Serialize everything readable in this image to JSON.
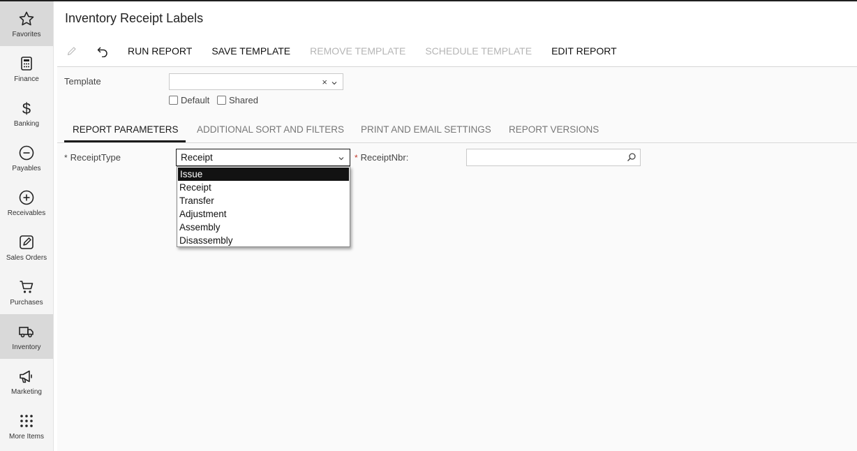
{
  "page": {
    "title": "Inventory Receipt Labels"
  },
  "sidebar": {
    "items": [
      {
        "label": "Favorites",
        "icon": "star-icon",
        "active": true
      },
      {
        "label": "Finance",
        "icon": "calculator-icon"
      },
      {
        "label": "Banking",
        "icon": "dollar-icon"
      },
      {
        "label": "Payables",
        "icon": "minus-circle-icon"
      },
      {
        "label": "Receivables",
        "icon": "plus-circle-icon"
      },
      {
        "label": "Sales Orders",
        "icon": "edit-icon"
      },
      {
        "label": "Purchases",
        "icon": "cart-icon"
      },
      {
        "label": "Inventory",
        "icon": "truck-icon",
        "active": true
      },
      {
        "label": "Marketing",
        "icon": "megaphone-icon"
      },
      {
        "label": "More Items",
        "icon": "grid-icon"
      }
    ]
  },
  "toolbar": {
    "edit_icon": "pencil-icon",
    "undo_icon": "undo-icon",
    "run_report": "RUN REPORT",
    "save_template": "SAVE TEMPLATE",
    "remove_template": "REMOVE TEMPLATE",
    "schedule_template": "SCHEDULE TEMPLATE",
    "edit_report": "EDIT REPORT"
  },
  "template": {
    "label": "Template",
    "value": "",
    "clear_glyph": "×",
    "default_label": "Default",
    "shared_label": "Shared"
  },
  "tabs": [
    {
      "label": "REPORT PARAMETERS",
      "active": true
    },
    {
      "label": "ADDITIONAL SORT AND FILTERS"
    },
    {
      "label": "PRINT AND EMAIL SETTINGS"
    },
    {
      "label": "REPORT VERSIONS"
    }
  ],
  "params": {
    "receipt_type_label": "ReceiptType",
    "receipt_type_value": "Receipt",
    "receipt_type_options": [
      "Issue",
      "Receipt",
      "Transfer",
      "Adjustment",
      "Assembly",
      "Disassembly"
    ],
    "highlighted_option": "Issue",
    "receipt_nbr_label": "ReceiptNbr:",
    "receipt_nbr_value": "",
    "required_marker": "*"
  },
  "colors": {
    "sidebar_bg": "#f4f4f4",
    "sidebar_active": "#d9d9d9",
    "required": "#c0392b",
    "disabled_text": "#b5b5b5"
  }
}
